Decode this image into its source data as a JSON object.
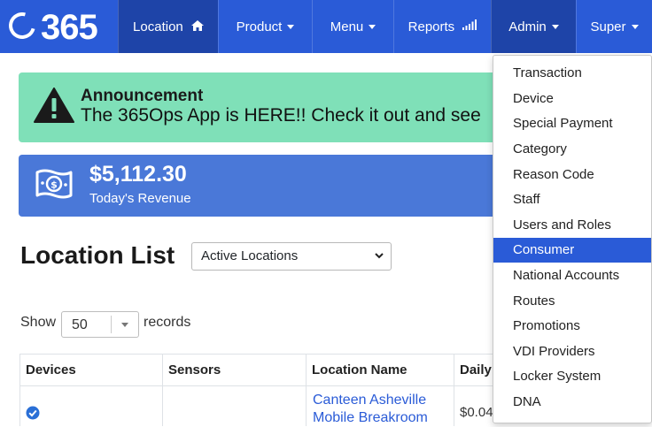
{
  "navbar": {
    "logo": "365",
    "items": [
      {
        "label": "Location",
        "icon": "home-icon"
      },
      {
        "label": "Product"
      },
      {
        "label": "Menu"
      },
      {
        "label": "Reports",
        "icon": "signal-icon"
      },
      {
        "label": "Admin"
      },
      {
        "label": "Super"
      }
    ]
  },
  "announcement": {
    "title": "Announcement",
    "text": "The 365Ops App is HERE!! Check it out and see"
  },
  "revenue": {
    "value": "$5,112.30",
    "label": "Today's Revenue"
  },
  "location_list": {
    "title": "Location List",
    "filter_selected": "Active Locations",
    "show_label": "Show",
    "page_size": "50",
    "records_label": "records"
  },
  "table": {
    "headers": [
      "Devices",
      "Sensors",
      "Location Name",
      "Daily"
    ],
    "rows": [
      {
        "location_name": "Canteen Asheville Mobile Breakroom",
        "daily": "$0.04"
      }
    ]
  },
  "admin_menu": {
    "items": [
      "Transaction",
      "Device",
      "Special Payment",
      "Category",
      "Reason Code",
      "Staff",
      "Users and Roles",
      "Consumer",
      "National Accounts",
      "Routes",
      "Promotions",
      "VDI Providers",
      "Locker System",
      "DNA"
    ],
    "active": "Consumer"
  },
  "colors": {
    "navbar": "#2a5bd7",
    "announcement": "#7fe0b8",
    "revenue": "#4a78d8",
    "link": "#2a5bd7"
  }
}
